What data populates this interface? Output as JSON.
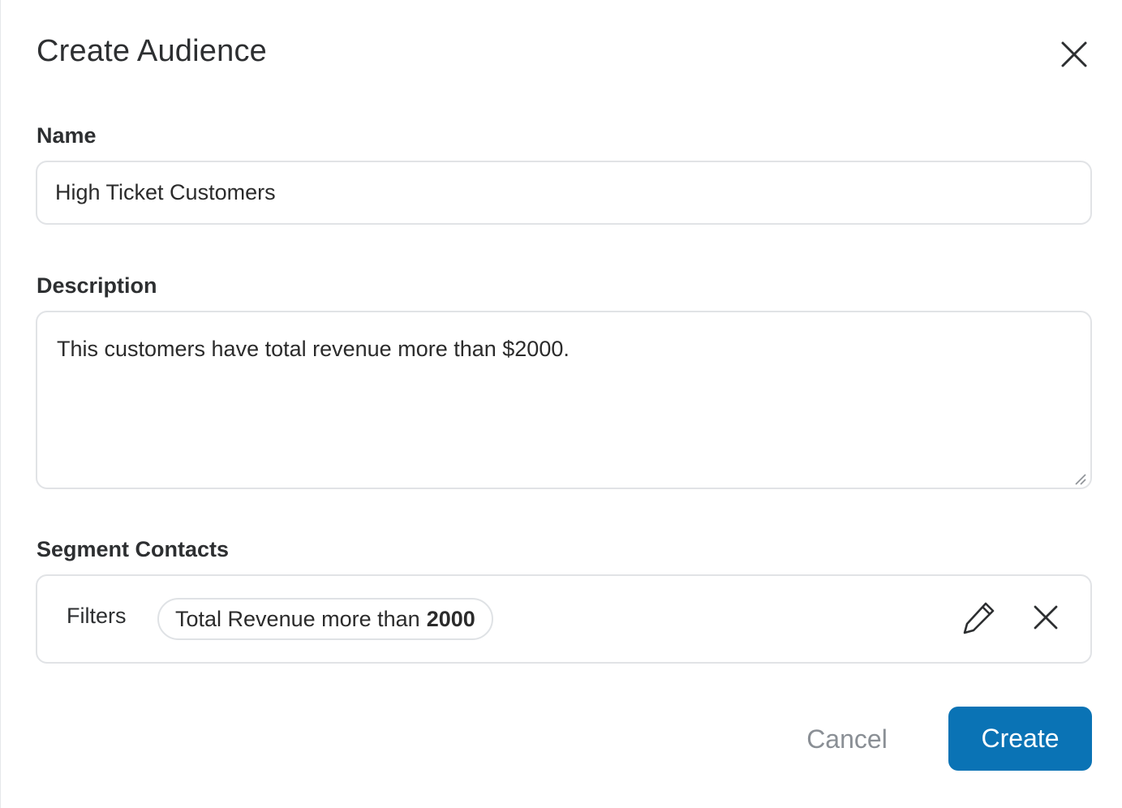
{
  "dialog": {
    "title": "Create Audience"
  },
  "form": {
    "name_label": "Name",
    "name_value": "High Ticket Customers",
    "description_label": "Description",
    "description_value": "This customers have total revenue more than $2000.",
    "segment_label": "Segment Contacts"
  },
  "segment": {
    "filters_label": "Filters",
    "filter_chip": {
      "text": "Total Revenue more than",
      "value": "2000"
    },
    "edit_icon": "pencil-icon",
    "remove_icon": "close-icon"
  },
  "actions": {
    "cancel_label": "Cancel",
    "create_label": "Create"
  },
  "colors": {
    "primary": "#0a73b5",
    "border": "#e1e3e6",
    "muted_text": "#8a8f95"
  }
}
